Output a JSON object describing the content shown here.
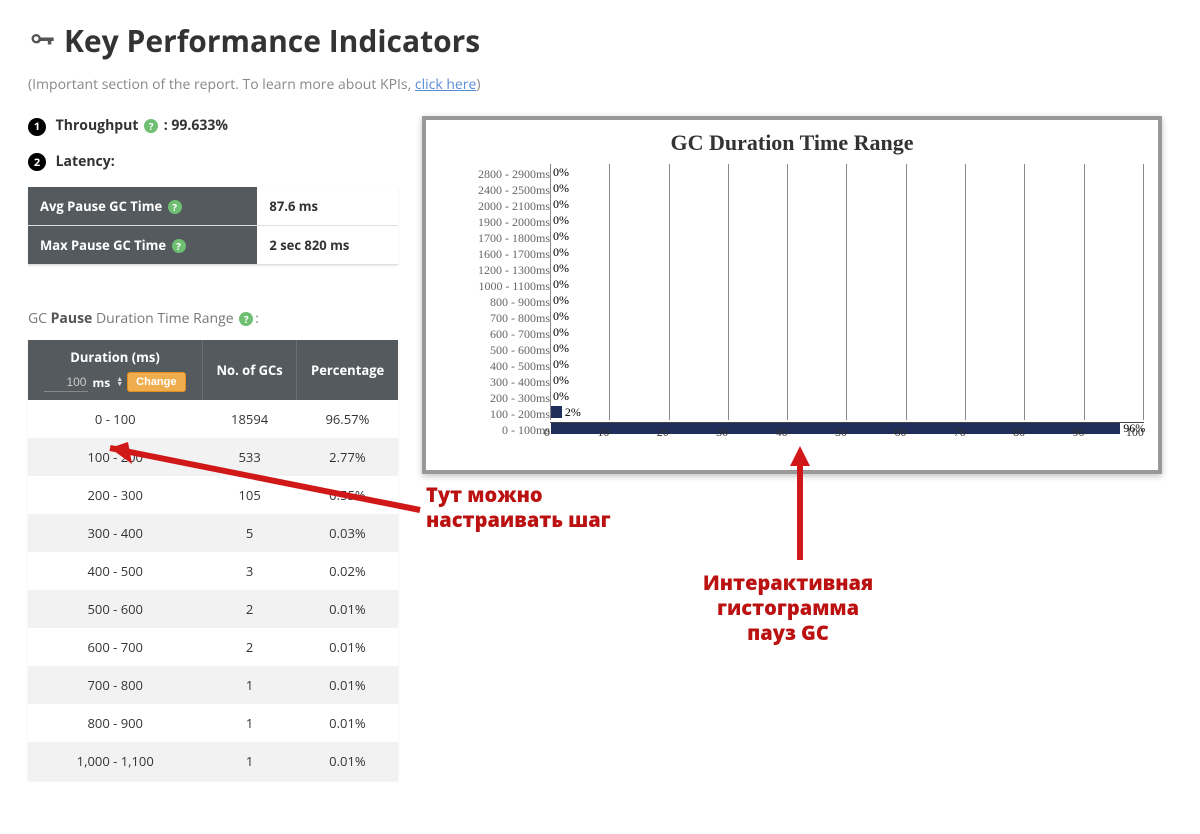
{
  "header": {
    "title": "Key Performance Indicators",
    "subtitle_prefix": "(Important section of the report. To learn more about KPIs, ",
    "subtitle_link": "click here",
    "subtitle_suffix": ")"
  },
  "kpi": {
    "throughput_label": "Throughput",
    "throughput_value": ": 99.633%",
    "latency_label": "Latency:"
  },
  "latency_table": {
    "rows": [
      {
        "label": "Avg Pause GC Time",
        "value": "87.6 ms"
      },
      {
        "label": "Max Pause GC Time",
        "value": "2 sec 820 ms"
      }
    ]
  },
  "section": {
    "prefix": "GC ",
    "bold": "Pause",
    "suffix": " Duration Time Range",
    "colon": ":"
  },
  "dur_header": {
    "col1": "Duration (ms)",
    "step_value": "100",
    "step_unit": "ms",
    "change": "Change",
    "col2": "No. of GCs",
    "col3": "Percentage"
  },
  "dur_rows": [
    {
      "range": "0 - 100",
      "count": "18594",
      "pct": "96.57%"
    },
    {
      "range": "100 - 200",
      "count": "533",
      "pct": "2.77%"
    },
    {
      "range": "200 - 300",
      "count": "105",
      "pct": "0.55%"
    },
    {
      "range": "300 - 400",
      "count": "5",
      "pct": "0.03%"
    },
    {
      "range": "400 - 500",
      "count": "3",
      "pct": "0.02%"
    },
    {
      "range": "500 - 600",
      "count": "2",
      "pct": "0.01%"
    },
    {
      "range": "600 - 700",
      "count": "2",
      "pct": "0.01%"
    },
    {
      "range": "700 - 800",
      "count": "1",
      "pct": "0.01%"
    },
    {
      "range": "800 - 900",
      "count": "1",
      "pct": "0.01%"
    },
    {
      "range": "1,000 - 1,100",
      "count": "1",
      "pct": "0.01%"
    }
  ],
  "annotations": {
    "step": "Тут можно настраивать шаг",
    "hist_line1": "Интерактивная",
    "hist_line2": "гистограмма",
    "hist_line3": "пауз GC"
  },
  "chart_data": {
    "type": "bar",
    "orientation": "horizontal",
    "title": "GC Duration Time Range",
    "xlabel": "",
    "ylabel": "",
    "xlim": [
      0,
      100
    ],
    "xticks": [
      0,
      10,
      20,
      30,
      40,
      50,
      60,
      70,
      80,
      90,
      100
    ],
    "categories": [
      "2800 - 2900ms",
      "2400 - 2500ms",
      "2000 - 2100ms",
      "1900 - 2000ms",
      "1700 - 1800ms",
      "1600 - 1700ms",
      "1200 - 1300ms",
      "1000 - 1100ms",
      "800 - 900ms",
      "700 - 800ms",
      "600 - 700ms",
      "500 - 600ms",
      "400 - 500ms",
      "300 - 400ms",
      "200 - 300ms",
      "100 - 200ms",
      "0 - 100ms"
    ],
    "values": [
      0,
      0,
      0,
      0,
      0,
      0,
      0,
      0,
      0,
      0,
      0,
      0,
      0,
      0,
      0,
      2,
      96
    ],
    "value_labels": [
      "0%",
      "0%",
      "0%",
      "0%",
      "0%",
      "0%",
      "0%",
      "0%",
      "0%",
      "0%",
      "0%",
      "0%",
      "0%",
      "0%",
      "0%",
      "2%",
      "96%"
    ]
  }
}
